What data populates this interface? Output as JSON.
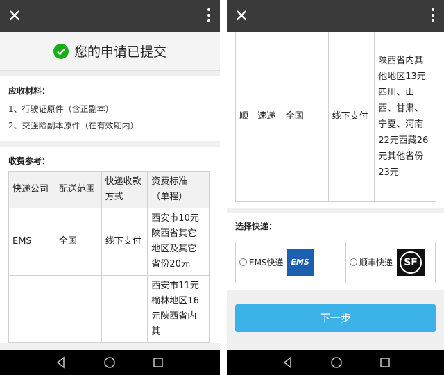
{
  "left_screen": {
    "success_title": "您的申请已提交",
    "materials": {
      "heading": "应收材料：",
      "items": [
        "1、行驶证原件（含正副本）",
        "2、交强险副本原件（在有效期内）"
      ]
    },
    "fees": {
      "heading": "收费参考：",
      "headers": [
        "快递公司",
        "配送范围",
        "快递收款方式",
        "资费标准（单程）"
      ],
      "rows": [
        [
          "EMS",
          "全国",
          "线下支付",
          "西安市10元陕西省其它地区及其它省份20元"
        ],
        [
          "",
          "",
          "",
          "西安市11元榆林地区16元陕西省内其"
        ]
      ]
    }
  },
  "right_screen": {
    "fees_row": [
      "顺丰速递",
      "全国",
      "线下支付",
      "陕西省内其他地区13元四川、山西、甘肃、宁夏、河南22元西藏26元其他省份23元"
    ],
    "express": {
      "heading": "选择快递：",
      "options": [
        {
          "label": "EMS快递",
          "logo_text": "EMS"
        },
        {
          "label": "顺丰快递",
          "logo_text": "SF"
        }
      ]
    },
    "next_button": "下一步"
  },
  "icons": {
    "close": "close-icon",
    "more": "more-vert-icon",
    "back": "nav-back-icon",
    "home": "nav-home-icon",
    "recent": "nav-recent-icon"
  },
  "colors": {
    "topbar": "#3a3a3a",
    "success_green": "#1aad19",
    "primary_button": "#3cb3e8",
    "ems_blue": "#1c5fae"
  }
}
